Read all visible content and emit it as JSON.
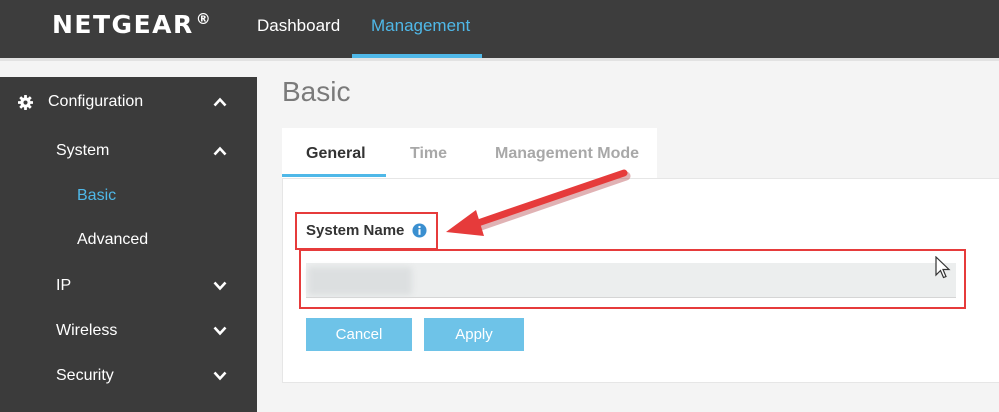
{
  "header": {
    "logo": "NETGEAR",
    "logo_mark": "®",
    "tabs": [
      {
        "label": "Dashboard",
        "active": false
      },
      {
        "label": "Management",
        "active": true
      }
    ]
  },
  "sidebar": {
    "items": [
      {
        "label": "Configuration",
        "icon": "gear-icon",
        "chevron": "up"
      },
      {
        "label": "System",
        "chevron": "up"
      },
      {
        "label": "Basic",
        "active": true
      },
      {
        "label": "Advanced"
      },
      {
        "label": "IP",
        "chevron": "down"
      },
      {
        "label": "Wireless",
        "chevron": "down"
      },
      {
        "label": "Security",
        "chevron": "down"
      }
    ]
  },
  "main": {
    "title": "Basic",
    "tabs": [
      {
        "label": "General",
        "active": true
      },
      {
        "label": "Time",
        "active": false
      },
      {
        "label": "Management Mode",
        "active": false
      }
    ],
    "form": {
      "system_name_label": "System Name",
      "info_icon": "info-icon",
      "system_name_value": ""
    },
    "buttons": {
      "cancel": "Cancel",
      "apply": "Apply"
    }
  },
  "colors": {
    "accent": "#4fb8e8",
    "topbar": "#3d3d3d",
    "sidebar": "#3b3b3b",
    "button": "#6ec3e8",
    "annotation": "#e63b3b"
  }
}
